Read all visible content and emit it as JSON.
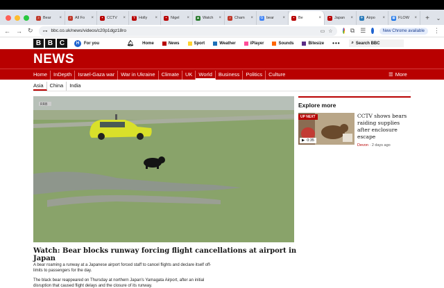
{
  "browser": {
    "tabs": [
      {
        "label": "Bear",
        "color": "#c0392b",
        "glyph": "♪"
      },
      {
        "label": "All Fo",
        "color": "#c0392b",
        "glyph": "♪"
      },
      {
        "label": "CCTV",
        "color": "#b80000",
        "glyph": "▪"
      },
      {
        "label": "Holly",
        "color": "#b80000",
        "glyph": "Y"
      },
      {
        "label": "Nigel",
        "color": "#b80000",
        "glyph": "▪"
      },
      {
        "label": "Watch",
        "color": "#2e7d32",
        "glyph": "▲"
      },
      {
        "label": "Cham",
        "color": "#c0392b",
        "glyph": "♪"
      },
      {
        "label": "bear",
        "color": "#4285f4",
        "glyph": "G"
      },
      {
        "label": "Be",
        "color": "#b80000",
        "glyph": "▪",
        "active": true
      },
      {
        "label": "Japan",
        "color": "#b80000",
        "glyph": "▪"
      },
      {
        "label": "Airpo",
        "color": "#2b7bb9",
        "glyph": "✈"
      },
      {
        "label": "FLOW",
        "color": "#1a73e8",
        "glyph": "▦"
      }
    ],
    "url": "bbc.co.uk/news/videos/c20p1dgz18ro",
    "new_chrome_label": "New Chrome available"
  },
  "bbc_header": {
    "logo_letters": [
      "B",
      "B",
      "C"
    ],
    "for_you": "For you",
    "avatar_letter": "H",
    "nav": [
      {
        "label": "Home",
        "color": ""
      },
      {
        "label": "News",
        "color": "#b80000"
      },
      {
        "label": "Sport",
        "color": "#ffd230"
      },
      {
        "label": "Weather",
        "color": "#1d70b8"
      },
      {
        "label": "iPlayer",
        "color": "#ff4c98"
      },
      {
        "label": "Sounds",
        "color": "#ff6600"
      },
      {
        "label": "Bitesize",
        "color": "#5b2d86"
      }
    ],
    "search_label": "Search BBC"
  },
  "news_banner": "NEWS",
  "red_nav": {
    "links": [
      "Home",
      "InDepth",
      "Israel-Gaza war",
      "War in Ukraine",
      "Climate",
      "UK",
      "World",
      "Business",
      "Politics",
      "Culture"
    ],
    "current": "World",
    "more_label": "More"
  },
  "sub_nav": [
    "Asia",
    "China",
    "India"
  ],
  "video": {
    "watermark": "RRB"
  },
  "article": {
    "headline": "Watch: Bear blocks runway forcing flight cancellations at airport in Japan",
    "paragraphs": [
      "A bear roaming a runway at a Japanese airport forced staff to cancel flights and declare itself off-limits to passengers for the day.",
      "The black bear reappeared on Thursday at northern Japan's Yamagata Airport, after an initial disruption that caused flight delays and the closure of its runway."
    ]
  },
  "explore": {
    "title": "Explore more",
    "card": {
      "badge": "UP NEXT",
      "duration": "0:35",
      "title": "CCTV shows bears raiding supplies after enclosure escape",
      "location": "Devon",
      "age": "2 days ago"
    }
  }
}
